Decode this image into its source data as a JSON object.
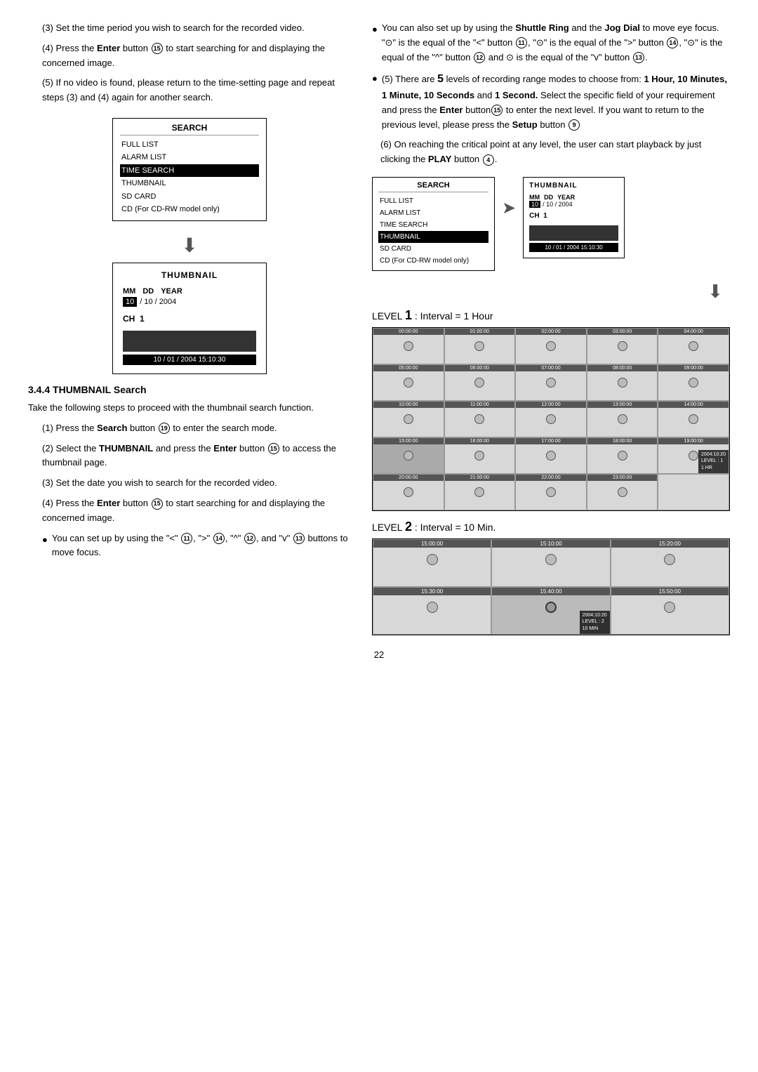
{
  "page": {
    "number": "22"
  },
  "left": {
    "steps_intro": [
      {
        "num": "(3)",
        "text": "Set the time period you wish to search for the recorded video."
      },
      {
        "num": "(4)",
        "text": "Press the Enter button",
        "circle": "15",
        "text2": "to start searching for and displaying the concerned image."
      },
      {
        "num": "(5)",
        "text": "If no video is found, please return to the time-setting page and repeat steps (3) and (4) again for another search."
      }
    ],
    "search_menu": {
      "title": "SEARCH",
      "items": [
        "FULL LIST",
        "ALARM LIST",
        "TIME SEARCH",
        "THUMBNAIL",
        "SD CARD",
        "CD (For CD-RW model only)"
      ],
      "selected_index": 2
    },
    "thumbnail_box": {
      "title": "THUMBNAIL",
      "mm": "MM",
      "dd": "DD",
      "year": "YEAR",
      "month_val": "10",
      "day_val": "10",
      "year_val": "2004",
      "ch_label": "CH",
      "ch_val": "1",
      "datetime_bar": "10 / 01 / 2004 15:10:30"
    },
    "section_heading": "3.4.4 THUMBNAIL Search",
    "thumb_steps": [
      {
        "num": "(1)",
        "text": "Press the Search button",
        "circle": "19",
        "text2": "to enter the search mode."
      },
      {
        "num": "(2)",
        "text": "Select the THUMBNAIL and press the Enter button",
        "circle": "15",
        "text2": "to access the thumbnail page."
      },
      {
        "num": "(3)",
        "text": "Set the date you wish to search for the recorded video."
      },
      {
        "num": "(4)",
        "text": "Press the Enter button",
        "circle": "15",
        "text2": "to start searching for and displaying the concerned image."
      }
    ],
    "bullet_steps": [
      {
        "text": "You can set up by using the \"<\"",
        "circle1": "11",
        "text2": "\">\"",
        "circle2": "14",
        "text3": ", \"^\"",
        "circle3": "12",
        "text4": ", and \"v\"",
        "circle4": "13",
        "text5": "buttons to move focus."
      }
    ]
  },
  "right": {
    "bullet_items": [
      {
        "text": "You can also set up by using the Shuttle Ring and the Jog Dial to move eye focus. \"◎\" is the equal of the \"<\" button ⑪, \"◎\" is the equal of the \">\" button ⑭, \"◎\" is the equal of the \"^\" button ⑫ and \"◎\" is the equal of the \"v\" button ⑬."
      },
      {
        "text": "There are 5 levels of recording range modes to choose from: 1 Hour, 10 Minutes, 1 Minute, 10 Seconds and 1 Second. Select the specific field of your requirement and press the Enter button⑮ to enter the next level. If you want to return to the previous level, please press the Setup button ⑨"
      },
      {
        "text": "On reaching the critical point at any level, the user can start playback by just clicking the PLAY button ④."
      }
    ],
    "right_search_menu": {
      "title": "SEARCH",
      "items": [
        "FULL LIST",
        "ALARM LIST",
        "TIME SEARCH",
        "THUMBNAIL",
        "SD CARD",
        "CD (For CD-RW model only)"
      ],
      "selected_index": 3
    },
    "right_thumbnail_box": {
      "title": "THUMBNAIL",
      "mm": "MM",
      "dd": "DD",
      "year": "YEAR",
      "month_val": "10",
      "day_val": "10",
      "year_val": "2004",
      "ch_label": "CH",
      "ch_val": "1",
      "datetime_bar": "10 / 01 / 2004 15:10:30"
    },
    "level1": {
      "label": "LEVEL",
      "num": "1",
      "interval": ": Interval = 1 Hour",
      "grid_times": [
        "00:00:00",
        "01:00:00",
        "02:00:00",
        "03:00:00",
        "04:00:00",
        "05:00:00",
        "06:00:00",
        "07:00:00",
        "08:00:00",
        "09:00:00",
        "10:00:00",
        "11:00:00",
        "12:00:00",
        "13:00:00",
        "14:00:00",
        "15:00:00",
        "16:00:00",
        "17:00:00",
        "18:00:00",
        "19:00:00",
        "20:00:00",
        "21:00:00",
        "22:00:00",
        "23:00:00",
        ""
      ],
      "selected_index": 15,
      "info": "2004:10:20\nLEVEL : 1\n1 HR"
    },
    "level2": {
      "label": "LEVEL",
      "num": "2",
      "interval": ": Interval = 10 Min.",
      "grid_times": [
        "15:00:00",
        "15:10:00",
        "15:20:00",
        "15:30:00",
        "15:40:00",
        "15:50:00"
      ],
      "selected_index": 4,
      "info": "2004:10:20\nLEVEL : 2\n10 MIN"
    }
  }
}
